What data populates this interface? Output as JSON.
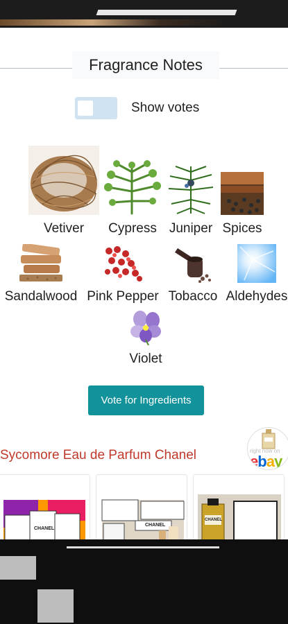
{
  "section": {
    "title": "Fragrance Notes"
  },
  "toggle": {
    "label": "Show votes",
    "on": false
  },
  "notes": [
    {
      "label": "Vetiver",
      "icon": "vetiver-icon"
    },
    {
      "label": "Cypress",
      "icon": "cypress-icon"
    },
    {
      "label": "Juniper",
      "icon": "juniper-icon"
    },
    {
      "label": "Spices",
      "icon": "spices-icon"
    },
    {
      "label": "Sandalwood",
      "icon": "sandalwood-icon"
    },
    {
      "label": "Pink Pepper",
      "icon": "pink-pepper-icon"
    },
    {
      "label": "Tobacco",
      "icon": "tobacco-icon"
    },
    {
      "label": "Aldehydes",
      "icon": "aldehydes-icon"
    },
    {
      "label": "Violet",
      "icon": "violet-icon"
    }
  ],
  "vote_button": {
    "label": "Vote for Ingredients"
  },
  "ebay": {
    "title": "Sycomore Eau de Parfum Chanel",
    "badge_text": "right now on",
    "logo_letters": [
      "e",
      "b",
      "a",
      "y"
    ],
    "products": [
      {
        "brand": "CHANEL",
        "icon": "perfume-box-set-icon"
      },
      {
        "brand": "CHANEL",
        "icon": "perfume-boxes-icon"
      },
      {
        "brand": "CHANEL",
        "icon": "perfume-bottle-box-icon"
      }
    ]
  },
  "colors": {
    "accent": "#12929a",
    "ebay_title": "#c0392b",
    "toggle_off": "#cfe3f3"
  }
}
